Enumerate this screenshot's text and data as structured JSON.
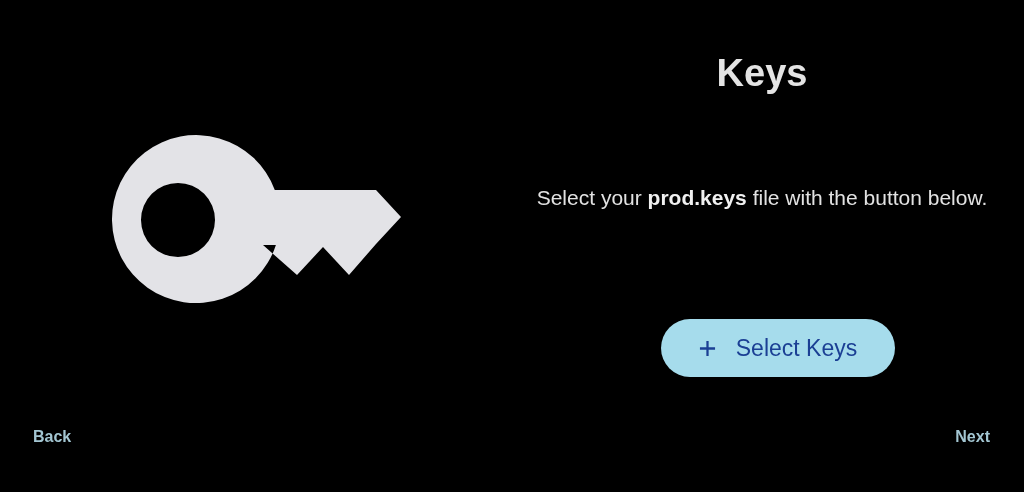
{
  "title": "Keys",
  "description": "Select your **prod.keys** file with the button below.",
  "action_button": {
    "label": "Select Keys"
  },
  "navigation": {
    "back": "Back",
    "next": "Next"
  }
}
